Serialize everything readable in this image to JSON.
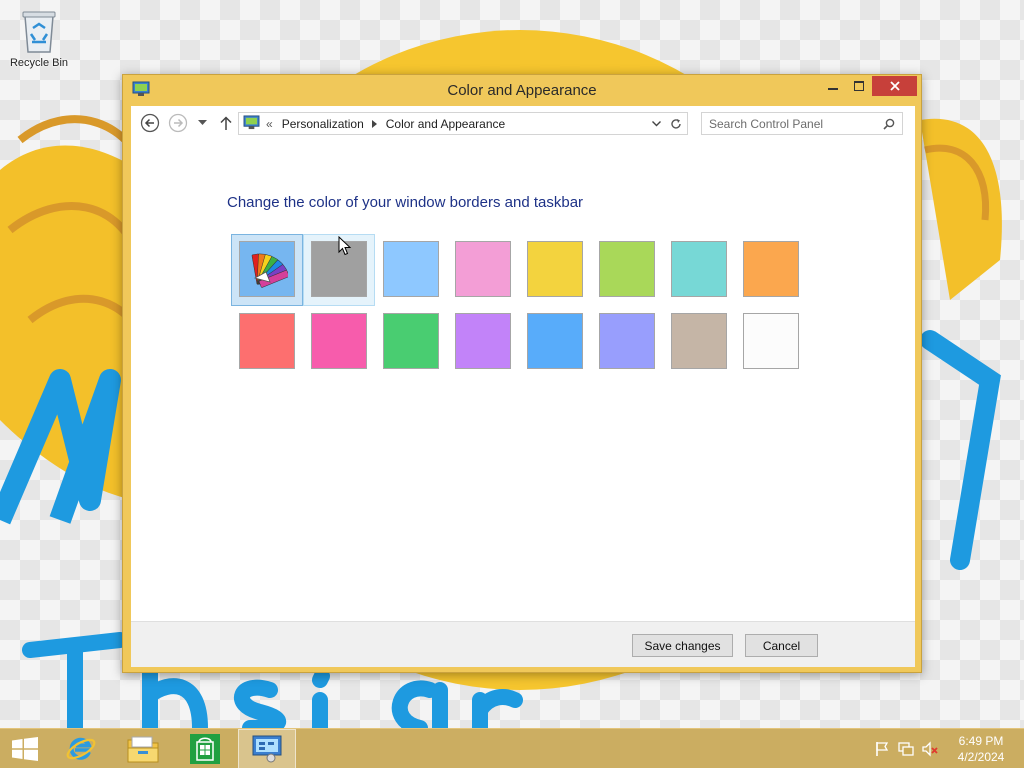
{
  "desktop": {
    "icons": [
      {
        "label": "Recycle Bin",
        "icon": "recycle-bin-icon"
      }
    ]
  },
  "window": {
    "title": "Color and Appearance",
    "app_icon": "control-panel-icon",
    "caption_buttons": {
      "minimize": "minimize-icon",
      "maximize": "maximize-icon",
      "close": "close-icon"
    }
  },
  "navigation": {
    "back_icon": "back-arrow-icon",
    "forward_icon": "forward-arrow-icon",
    "recent_icon": "chevron-down-icon",
    "up_icon": "up-arrow-icon",
    "address": {
      "prefix": "«",
      "crumbs": [
        "Personalization",
        "Color and Appearance"
      ]
    },
    "search": {
      "placeholder": "Search Control Panel"
    }
  },
  "main": {
    "heading": "Change the color of your window borders and taskbar",
    "swatches": [
      {
        "color": "#76b6f0",
        "icon": "color-fan-icon",
        "state": "selected"
      },
      {
        "color": "#a0a0a0",
        "state": "hover"
      },
      {
        "color": "#8ec8ff"
      },
      {
        "color": "#f39ed6"
      },
      {
        "color": "#f3d33e"
      },
      {
        "color": "#a9d859"
      },
      {
        "color": "#77d8d6"
      },
      {
        "color": "#fba74e"
      },
      {
        "color": "#fd6f6f"
      },
      {
        "color": "#f75cac"
      },
      {
        "color": "#49cd71"
      },
      {
        "color": "#c283f9"
      },
      {
        "color": "#58acfa"
      },
      {
        "color": "#989efd"
      },
      {
        "color": "#c5b5a6"
      },
      {
        "color": "#fcfcfc"
      }
    ]
  },
  "footer": {
    "save_label": "Save changes",
    "cancel_label": "Cancel"
  },
  "taskbar": {
    "items": [
      {
        "name": "start-button",
        "icon": "windows-logo-icon"
      },
      {
        "name": "internet-explorer",
        "icon": "internet-explorer-icon"
      },
      {
        "name": "file-explorer",
        "icon": "file-explorer-icon"
      },
      {
        "name": "store",
        "icon": "store-icon"
      },
      {
        "name": "control-panel",
        "icon": "control-panel-icon",
        "active": true
      }
    ],
    "tray_icons": [
      "action-center-flag-icon",
      "network-icon",
      "volume-muted-icon"
    ],
    "clock": {
      "time": "6:49 PM",
      "date": "4/2/2024"
    }
  },
  "colors": {
    "window_border": "#f0c85a",
    "close_button": "#c7403a",
    "heading_text": "#1e3287",
    "taskbar": "#c8a856"
  }
}
